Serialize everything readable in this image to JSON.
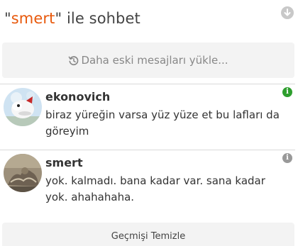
{
  "header": {
    "prefix": "\"",
    "username": "smert",
    "suffix": "\" ile sohbet"
  },
  "load_older": {
    "icon": "history-icon",
    "label": "Daha eski mesajları yükle..."
  },
  "messages": [
    {
      "username": "ekonovich",
      "text": "biraz yüreğin varsa yüz yüze et bu lafları da göreyim",
      "info_icon": "info-icon",
      "info_color": "#2e9e2e"
    },
    {
      "username": "smert",
      "text": "yok. kalmadı. bana kadar var. sana kadar yok. ahahahaha.",
      "info_icon": "info-icon",
      "info_color": "#999999"
    }
  ],
  "clear_history": {
    "label": "Geçmişi Temizle"
  },
  "colors": {
    "accent": "#e8590c",
    "panel_bg": "#f3f3f3",
    "divider": "#d9d9d9"
  }
}
